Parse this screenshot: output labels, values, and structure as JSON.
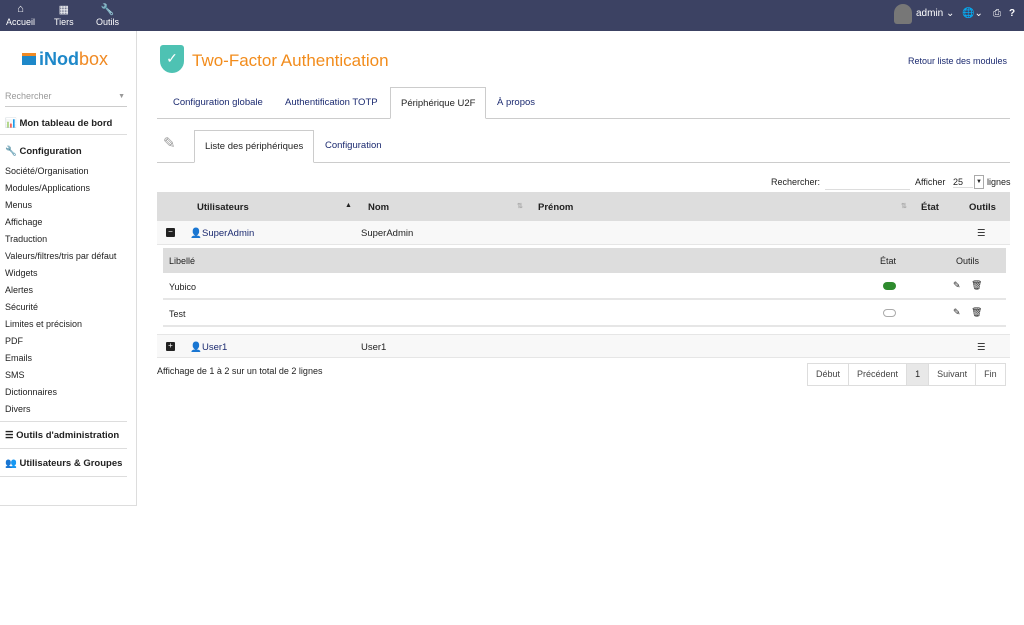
{
  "topbar": {
    "nav": [
      {
        "label": "Accueil",
        "icon": "home-icon"
      },
      {
        "label": "Tiers",
        "icon": "building-icon"
      },
      {
        "label": "Outils",
        "icon": "wrench-icon"
      }
    ],
    "user": "admin"
  },
  "sidebar": {
    "logo": "iNodbox",
    "search_placeholder": "Rechercher",
    "dashboard": "Mon tableau de bord",
    "config_heading": "Configuration",
    "items": [
      "Société/Organisation",
      "Modules/Applications",
      "Menus",
      "Affichage",
      "Traduction",
      "Valeurs/filtres/tris par défaut",
      "Widgets",
      "Alertes",
      "Sécurité",
      "Limites et précision",
      "PDF",
      "Emails",
      "SMS",
      "Dictionnaires",
      "Divers"
    ],
    "admin_tools": "Outils d'administration",
    "users_groups": "Utilisateurs & Groupes"
  },
  "page": {
    "title": "Two-Factor Authentication",
    "back_link": "Retour liste des modules",
    "tabs": [
      "Configuration globale",
      "Authentification TOTP",
      "Périphérique U2F",
      "À propos"
    ],
    "subtabs": [
      "Liste des périphériques",
      "Configuration"
    ]
  },
  "table": {
    "search_label": "Rechercher:",
    "show_label": "Afficher",
    "page_size": "25",
    "lines_label": "lignes",
    "headers": [
      "Utilisateurs",
      "Nom",
      "Prénom",
      "État",
      "Outils"
    ],
    "rows": [
      {
        "user": "SuperAdmin",
        "nom": "SuperAdmin"
      },
      {
        "user": "User1",
        "nom": "User1"
      }
    ],
    "sub_headers": [
      "Libellé",
      "État",
      "Outils"
    ],
    "devices": [
      {
        "label": "Yubico",
        "enabled": true
      },
      {
        "label": "Test",
        "enabled": false
      }
    ],
    "info": "Affichage de 1 à 2 sur un total de 2 lignes",
    "pager": [
      "Début",
      "Précédent",
      "1",
      "Suivant",
      "Fin"
    ]
  },
  "colors": {
    "topbar": "#3c4263",
    "accent": "#f28c1c",
    "link": "#1b2a70",
    "toggle_on": "#2e8b2e"
  }
}
